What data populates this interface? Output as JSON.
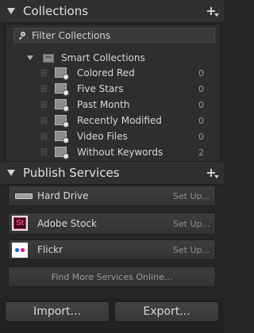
{
  "collections": {
    "title": "Collections",
    "filter_placeholder": "Filter Collections",
    "root_label": "Smart Collections",
    "items": [
      {
        "label": "Colored Red",
        "count": "0"
      },
      {
        "label": "Five Stars",
        "count": "0"
      },
      {
        "label": "Past Month",
        "count": "0"
      },
      {
        "label": "Recently Modified",
        "count": "0"
      },
      {
        "label": "Video Files",
        "count": "0"
      },
      {
        "label": "Without Keywords",
        "count": "2"
      }
    ]
  },
  "publish": {
    "title": "Publish Services",
    "services": [
      {
        "name": "Hard Drive",
        "action": "Set Up...",
        "icon": "hard-drive-icon"
      },
      {
        "name": "Adobe Stock",
        "action": "Set Up...",
        "icon": "adobe-stock-icon",
        "icon_text": "St"
      },
      {
        "name": "Flickr",
        "action": "Set Up...",
        "icon": "flickr-icon"
      }
    ],
    "find_more": "Find More Services Online..."
  },
  "footer": {
    "import_label": "Import...",
    "export_label": "Export..."
  }
}
